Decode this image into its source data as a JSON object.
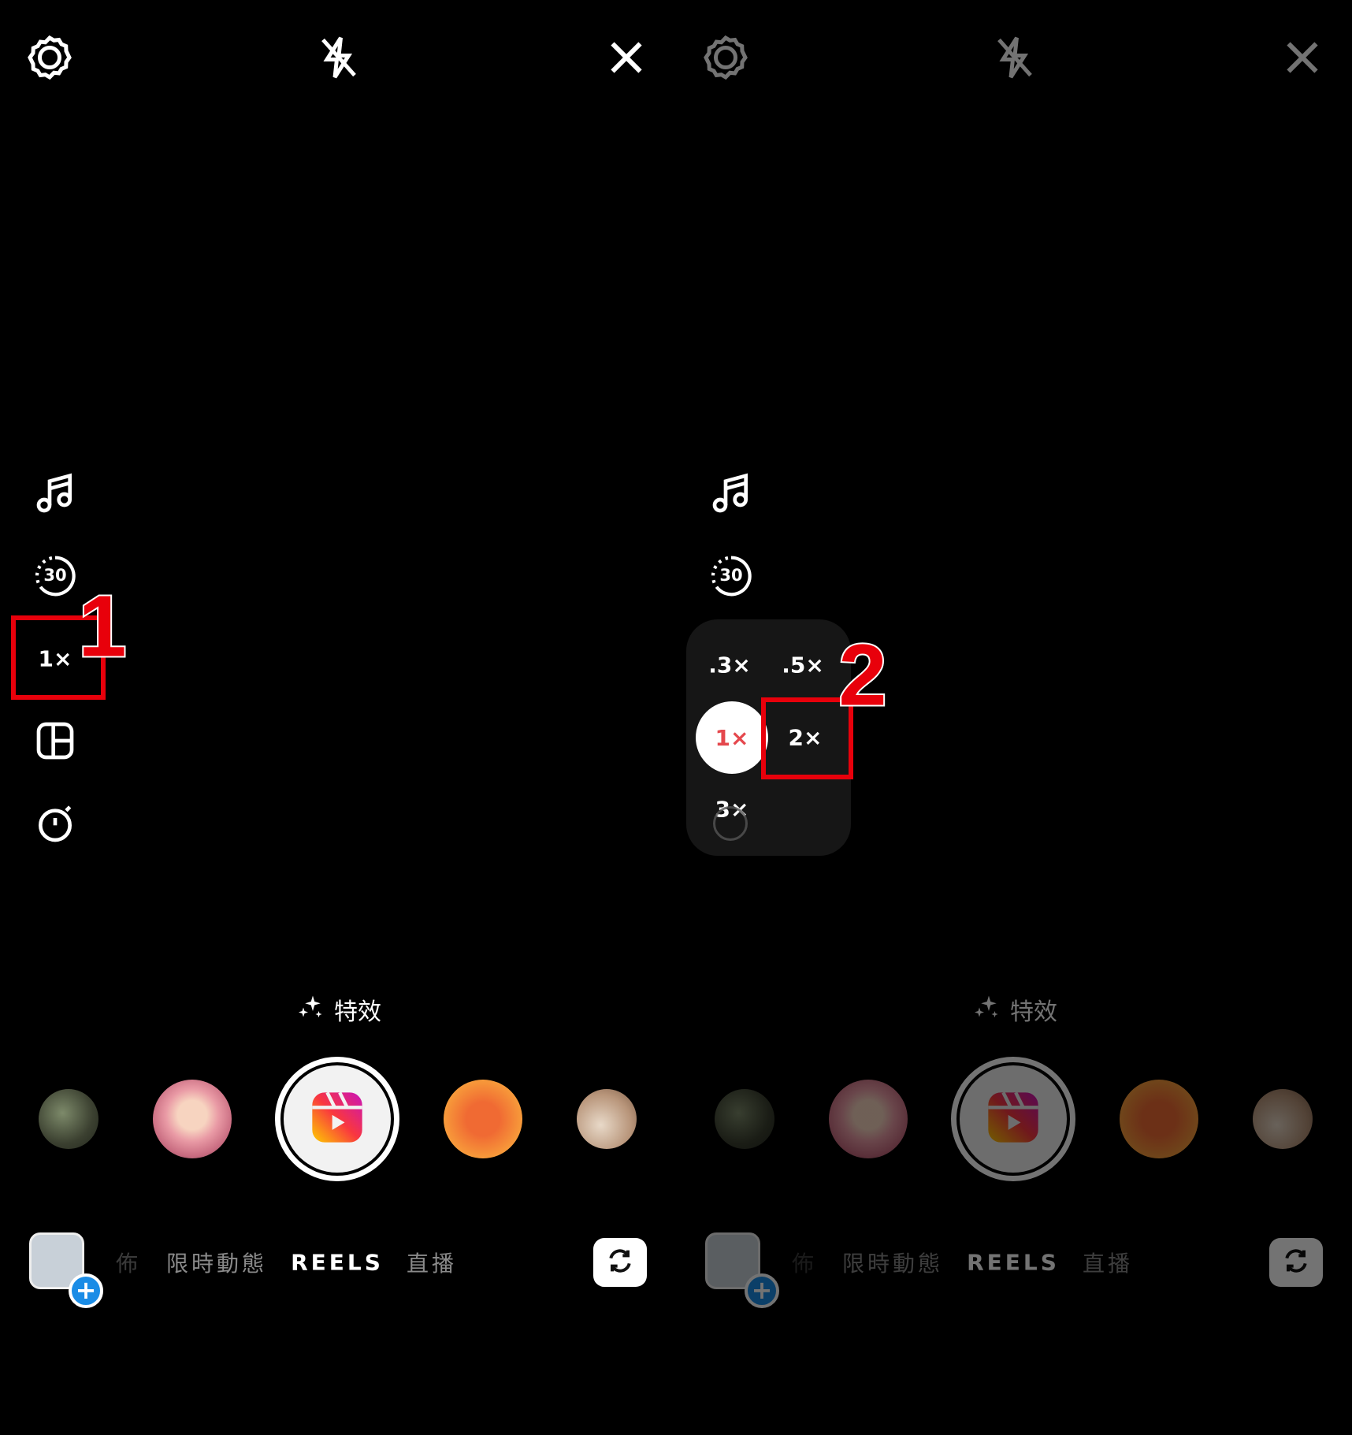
{
  "panels": [
    {
      "id": "left",
      "dimmed": false,
      "zoom_label": "1×"
    },
    {
      "id": "right",
      "dimmed": true
    }
  ],
  "top_bar": {
    "icons": [
      "settings-icon",
      "flash-off-icon",
      "close-icon"
    ]
  },
  "side_tools": {
    "duration_label": "30",
    "zoom_label": "1×",
    "icons": [
      "music-icon",
      "duration-icon",
      "zoom-icon",
      "layout-icon",
      "timer-icon"
    ]
  },
  "effects": {
    "label": "特效",
    "icon": "sparkles-icon"
  },
  "carousel": {
    "items": [
      "filter-thumbnail-garden",
      "filter-thumbnail-anime",
      "reels-shutter",
      "filter-thumbnail-orange",
      "filter-thumbnail-room"
    ]
  },
  "modes": {
    "items": [
      {
        "label": "佈"
      },
      {
        "label": "限時動態"
      },
      {
        "label": "REELS",
        "active": true
      },
      {
        "label": "直播"
      }
    ]
  },
  "gallery": {
    "plus": "+"
  },
  "zoom_popup": {
    "options": [
      ".3×",
      ".5×",
      "1×",
      "2×",
      "3×"
    ],
    "selected": "1×"
  },
  "annotations": {
    "step1": "1",
    "step2": "2",
    "color": "#e8000b"
  },
  "colors": {
    "accent_blue": "#1a8ce6",
    "reels_gradient": [
      "#c913b9",
      "#f9373f",
      "#fecd00"
    ]
  }
}
